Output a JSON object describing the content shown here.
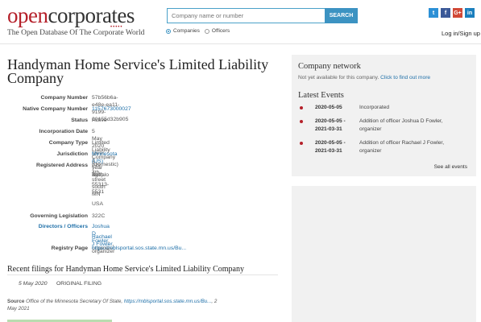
{
  "header": {
    "logo_part1": "open",
    "logo_part2": "corporates",
    "logo_dots": "•••••",
    "tagline": "The Open Database Of The Corporate World",
    "search_placeholder": "Company name or number",
    "search_button": "SEARCH",
    "radio_companies": "Companies",
    "radio_officers": "Officers",
    "social": [
      {
        "label": "t",
        "color": "#2c90d6"
      },
      {
        "label": "f",
        "color": "#3b5998"
      },
      {
        "label": "G+",
        "color": "#d14836"
      },
      {
        "label": "in",
        "color": "#1b7fbd"
      }
    ],
    "login": "Log in/Sign up"
  },
  "company": {
    "name": "Handyman Home Service's Limited Liability Company",
    "fields": {
      "company_number_label": "Company Number",
      "company_number": "57b56b6a-e48e-ea11-9199-00155d32b905",
      "native_number_label": "Native Company Number",
      "native_number": "1157673000027",
      "status_label": "Status",
      "status": "Active",
      "incorporation_label": "Incorporation Date",
      "incorporation": "5 May 2020 (over 1 year ago)",
      "type_label": "Company Type",
      "type": "Limited Liability Company (Domestic)",
      "jurisdiction_label": "Jurisdiction",
      "jurisdiction": "Minnesota (US)",
      "address_label": "Registered Address",
      "address_lines": [
        "711 4th street south",
        "Buffalo",
        "55313-5531",
        "MN",
        "USA"
      ],
      "legislation_label": "Governing Legislation",
      "legislation": "322C",
      "officers_label": "Directors / Officers",
      "officers": [
        {
          "name": "Joshua D Fowler",
          "role": ", organizer"
        },
        {
          "name": "Rachael J Fowler",
          "role": ", organizer"
        }
      ],
      "registry_label": "Registry Page",
      "registry": "https://mblsportal.sos.state.mn.us/Bu..."
    }
  },
  "filings": {
    "heading": "Recent filings for Handyman Home Service's Limited Liability Company",
    "items": [
      {
        "date": "5 May 2020",
        "name": "ORIGINAL FILING"
      }
    ],
    "source_label": "Source",
    "source_text": " Office of the Minnesota Secretary Of State, ",
    "source_link": "https://mblsportal.sos.state.mn.us/Bu...",
    "source_date": ", 2 May 2021"
  },
  "sidebar": {
    "network_title": "Company network",
    "network_text": "Not yet available for this company. ",
    "network_link": "Click to find out more",
    "events_title": "Latest Events",
    "events": [
      {
        "date": "2020-05-05",
        "text": "Incorporated"
      },
      {
        "date": "2020-05-05 - 2021-03-31",
        "text": "Addition of officer Joshua D Fowler, organizer"
      },
      {
        "date": "2020-05-05 - 2021-03-31",
        "text": "Addition of officer Rachael J Fowler, organizer"
      }
    ],
    "all_events": "See all events"
  }
}
